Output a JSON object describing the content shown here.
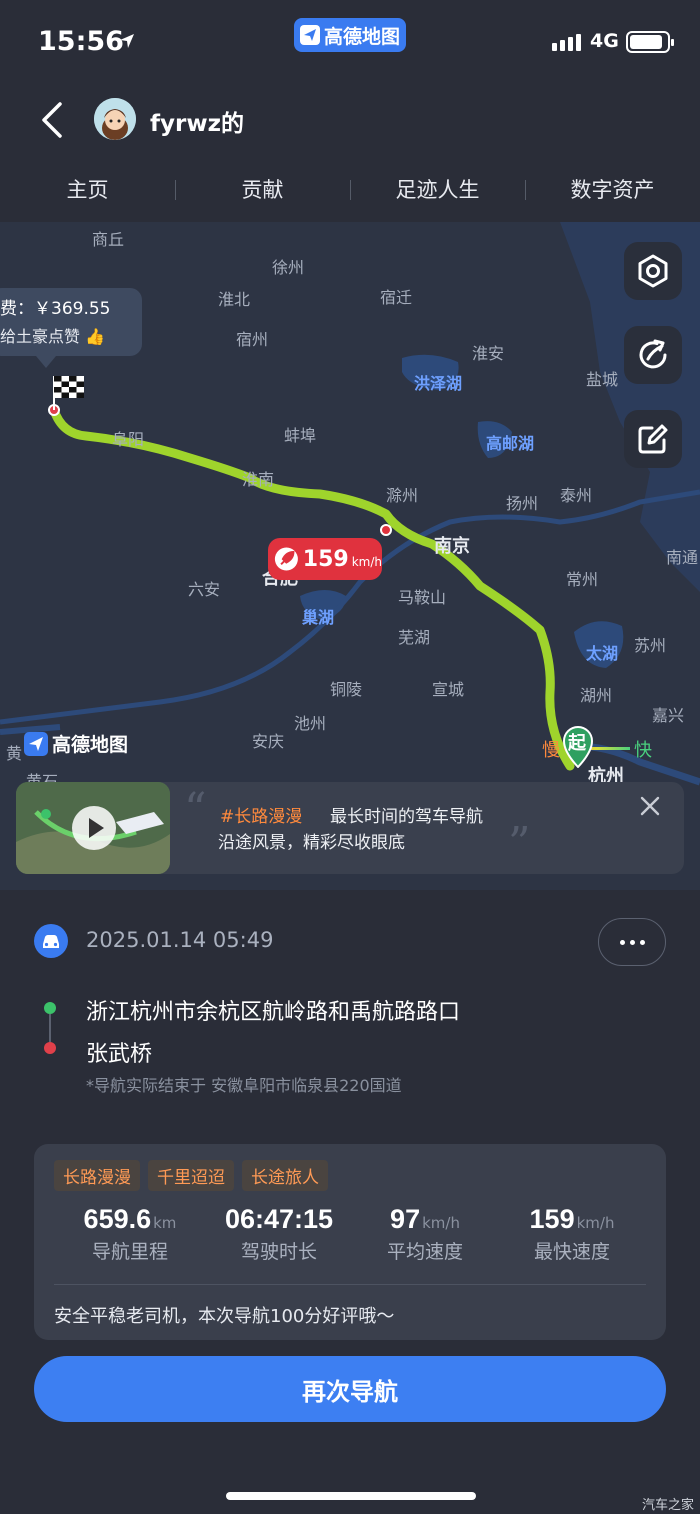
{
  "status_bar": {
    "time": "15:56",
    "app_pill": "高德地图",
    "network": "4G"
  },
  "header": {
    "username": "fyrwz的"
  },
  "tabs": [
    "主页",
    "贡献",
    "足迹人生",
    "数字资产"
  ],
  "map": {
    "cities": [
      "商丘",
      "徐州",
      "淮北",
      "宿迁",
      "宿州",
      "淮安",
      "盐城",
      "阜阳",
      "蚌埠",
      "淮南",
      "扬州",
      "泰州",
      "滁州",
      "南京",
      "南通",
      "六安",
      "合肥",
      "马鞍山",
      "常州",
      "芜湖",
      "苏州",
      "湖州",
      "铜陵",
      "宣城",
      "池州",
      "嘉兴",
      "安庆",
      "杭州",
      "黄",
      "黄石"
    ],
    "lakes": [
      "洪泽湖",
      "高邮湖",
      "巢湖",
      "太湖"
    ],
    "fee_line1": "费：￥369.55",
    "fee_line2": "给土豪点赞 👍",
    "max_speed_value": "159",
    "max_speed_unit": "km/h",
    "start_label": "起",
    "slow_label": "慢",
    "fast_label": "快",
    "logo_text": "高德地图",
    "route_color": "#9fd42c"
  },
  "banner": {
    "tag": "#长路漫漫",
    "title": "最长时间的驾车导航",
    "subtitle": "沿途风景，精彩尽收眼底"
  },
  "trip": {
    "datetime": "2025.01.14 05:49",
    "origin": "浙江杭州市余杭区航岭路和禹航路路口",
    "destination": "张武桥",
    "note": "*导航实际结束于 安徽阜阳市临泉县220国道"
  },
  "stats": {
    "tags": [
      "长路漫漫",
      "千里迢迢",
      "长途旅人"
    ],
    "items": [
      {
        "value": "659.6",
        "unit": "km",
        "label": "导航里程"
      },
      {
        "value": "06:47:15",
        "unit": "",
        "label": "驾驶时长"
      },
      {
        "value": "97",
        "unit": "km/h",
        "label": "平均速度"
      },
      {
        "value": "159",
        "unit": "km/h",
        "label": "最快速度"
      }
    ],
    "footer": "安全平稳老司机，本次导航100分好评哦～"
  },
  "renavigate_label": "再次导航",
  "watermark": "汽车之家",
  "colors": {
    "accent": "#3d7ff2",
    "tag_orange": "#ff9a55",
    "speed_red": "#e0323e"
  }
}
